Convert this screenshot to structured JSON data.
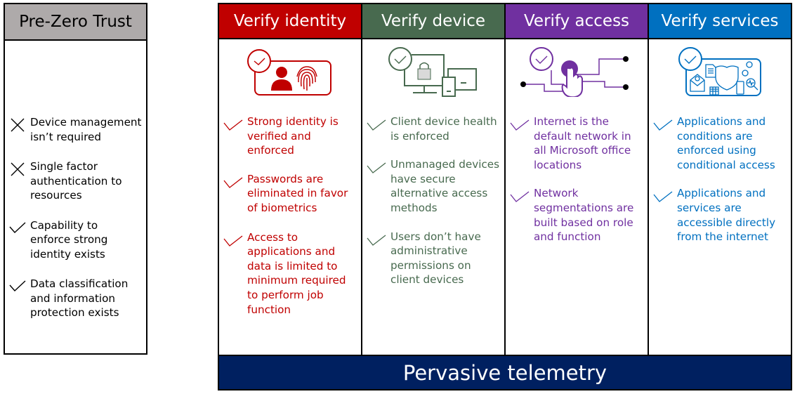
{
  "pre_zero_trust": {
    "title": "Pre-Zero Trust",
    "header_color": "#aeaaaa",
    "items": [
      {
        "mark": "x-icon",
        "text": "Device management isn’t required"
      },
      {
        "mark": "check-icon",
        "text": "Single factor authentication to resources"
      },
      {
        "mark": "check-icon",
        "text": "Capability to enforce strong identity exists"
      },
      {
        "mark": "check-icon",
        "text": "Data classification and information protection exists"
      }
    ]
  },
  "pillars": [
    {
      "title": "Verify identity",
      "color": "#c00000",
      "icon": "identity-fingerprint-icon",
      "items": [
        "Strong identity is verified and enforced",
        "Passwords are eliminated in favor of biometrics",
        "Access to applications and data is limited to minimum required to perform job function"
      ]
    },
    {
      "title": "Verify device",
      "color": "#486a4f",
      "icon": "device-lock-icon",
      "items": [
        "Client device health is enforced",
        "Unmanaged devices have secure alternative access methods",
        "Users don’t have administrative permissions on client devices"
      ]
    },
    {
      "title": "Verify access",
      "color": "#7030a0",
      "icon": "network-touch-icon",
      "items": [
        "Internet is the default network in all Microsoft office locations",
        "Network segmentations are built based on role and function"
      ]
    },
    {
      "title": "Verify services",
      "color": "#0070c0",
      "icon": "services-shield-icon",
      "items": [
        "Applications and conditions are enforced using conditional access",
        "Applications and services are accessible directly from the internet"
      ]
    }
  ],
  "footer": {
    "title": "Pervasive telemetry",
    "color": "#002060"
  }
}
